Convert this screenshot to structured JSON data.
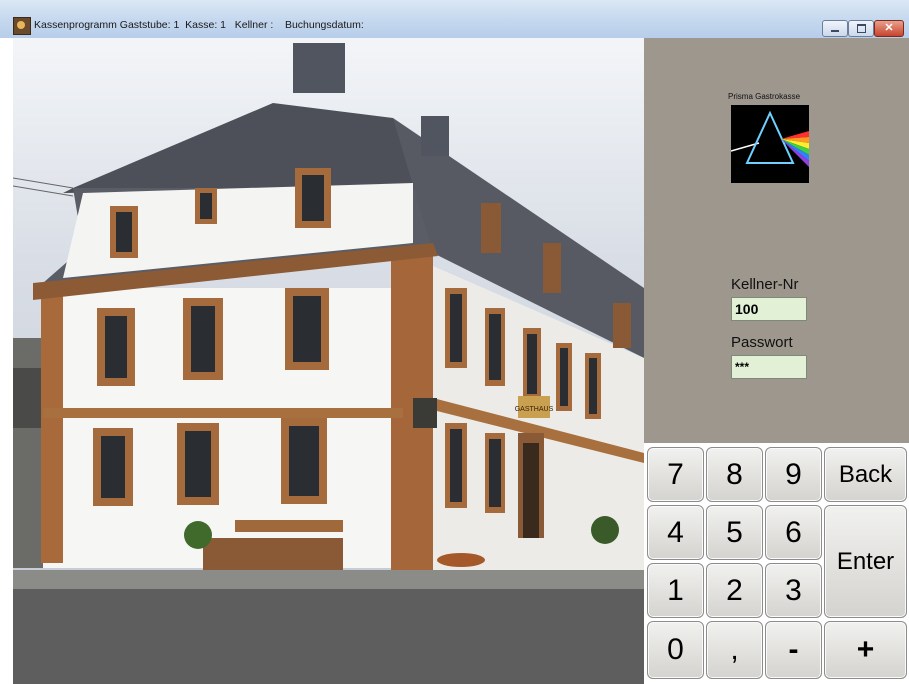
{
  "window": {
    "title": "Kassenprogramm Gaststube: 1  Kasse: 1   Kellner :    Buchungsdatum:"
  },
  "login": {
    "logo_caption": "Prisma Gastrokasse",
    "kellner_label": "Kellner-Nr",
    "kellner_value": "100",
    "passwort_label": "Passwort",
    "passwort_value": "***"
  },
  "keypad": {
    "k7": "7",
    "k8": "8",
    "k9": "9",
    "back": "Back",
    "k4": "4",
    "k5": "5",
    "k6": "6",
    "enter": "Enter",
    "k1": "1",
    "k2": "2",
    "k3": "3",
    "k0": "0",
    "comma": ",",
    "minus": "-",
    "plus": "+"
  },
  "photo": {
    "sign": "GASTHAUS"
  }
}
